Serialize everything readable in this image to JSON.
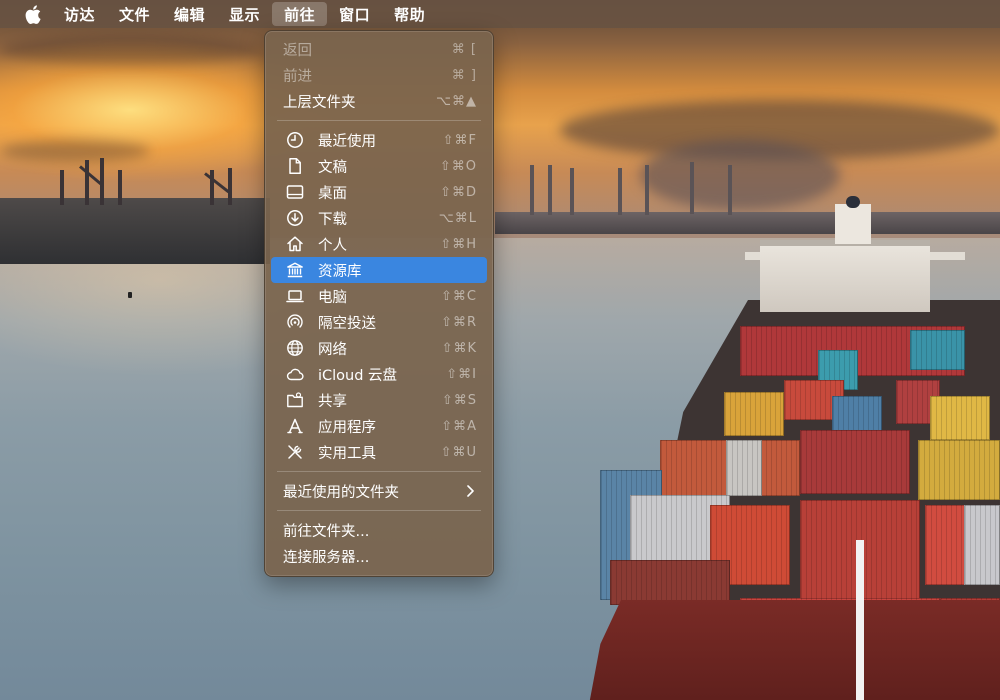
{
  "menubar": {
    "apple_icon": "apple-logo-icon",
    "menus": [
      "访达",
      "文件",
      "编辑",
      "显示",
      "前往",
      "窗口",
      "帮助"
    ],
    "active_menu": "前往"
  },
  "go_menu": {
    "back": {
      "label": "返回",
      "shortcut": "⌘ [",
      "enabled": false
    },
    "forward": {
      "label": "前进",
      "shortcut": "⌘ ]",
      "enabled": false
    },
    "enclosing_folder": {
      "label": "上层文件夹",
      "shortcut": "⌥⌘▲"
    },
    "places": [
      {
        "label": "最近使用",
        "shortcut": "⇧⌘F",
        "icon": "clock-icon"
      },
      {
        "label": "文稿",
        "shortcut": "⇧⌘O",
        "icon": "document-icon"
      },
      {
        "label": "桌面",
        "shortcut": "⇧⌘D",
        "icon": "desktop-icon"
      },
      {
        "label": "下载",
        "shortcut": "⌥⌘L",
        "icon": "download-icon"
      },
      {
        "label": "个人",
        "shortcut": "⇧⌘H",
        "icon": "home-icon"
      },
      {
        "label": "资源库",
        "shortcut": "",
        "icon": "library-icon",
        "highlighted": true
      },
      {
        "label": "电脑",
        "shortcut": "⇧⌘C",
        "icon": "laptop-icon"
      },
      {
        "label": "隔空投送",
        "shortcut": "⇧⌘R",
        "icon": "airdrop-icon"
      },
      {
        "label": "网络",
        "shortcut": "⇧⌘K",
        "icon": "globe-icon"
      },
      {
        "label": "iCloud 云盘",
        "shortcut": "⇧⌘I",
        "icon": "cloud-icon"
      },
      {
        "label": "共享",
        "shortcut": "⇧⌘S",
        "icon": "shared-folder-icon"
      },
      {
        "label": "应用程序",
        "shortcut": "⇧⌘A",
        "icon": "applications-icon"
      },
      {
        "label": "实用工具",
        "shortcut": "⇧⌘U",
        "icon": "utilities-icon"
      }
    ],
    "recent_folders": {
      "label": "最近使用的文件夹"
    },
    "go_to_folder": {
      "label": "前往文件夹..."
    },
    "connect_to_server": {
      "label": "连接服务器..."
    }
  },
  "colors": {
    "menubar_bg": "#685242",
    "menu_bg": "#7a644e",
    "highlight": "#3a86e0",
    "text": "#ffffff"
  }
}
